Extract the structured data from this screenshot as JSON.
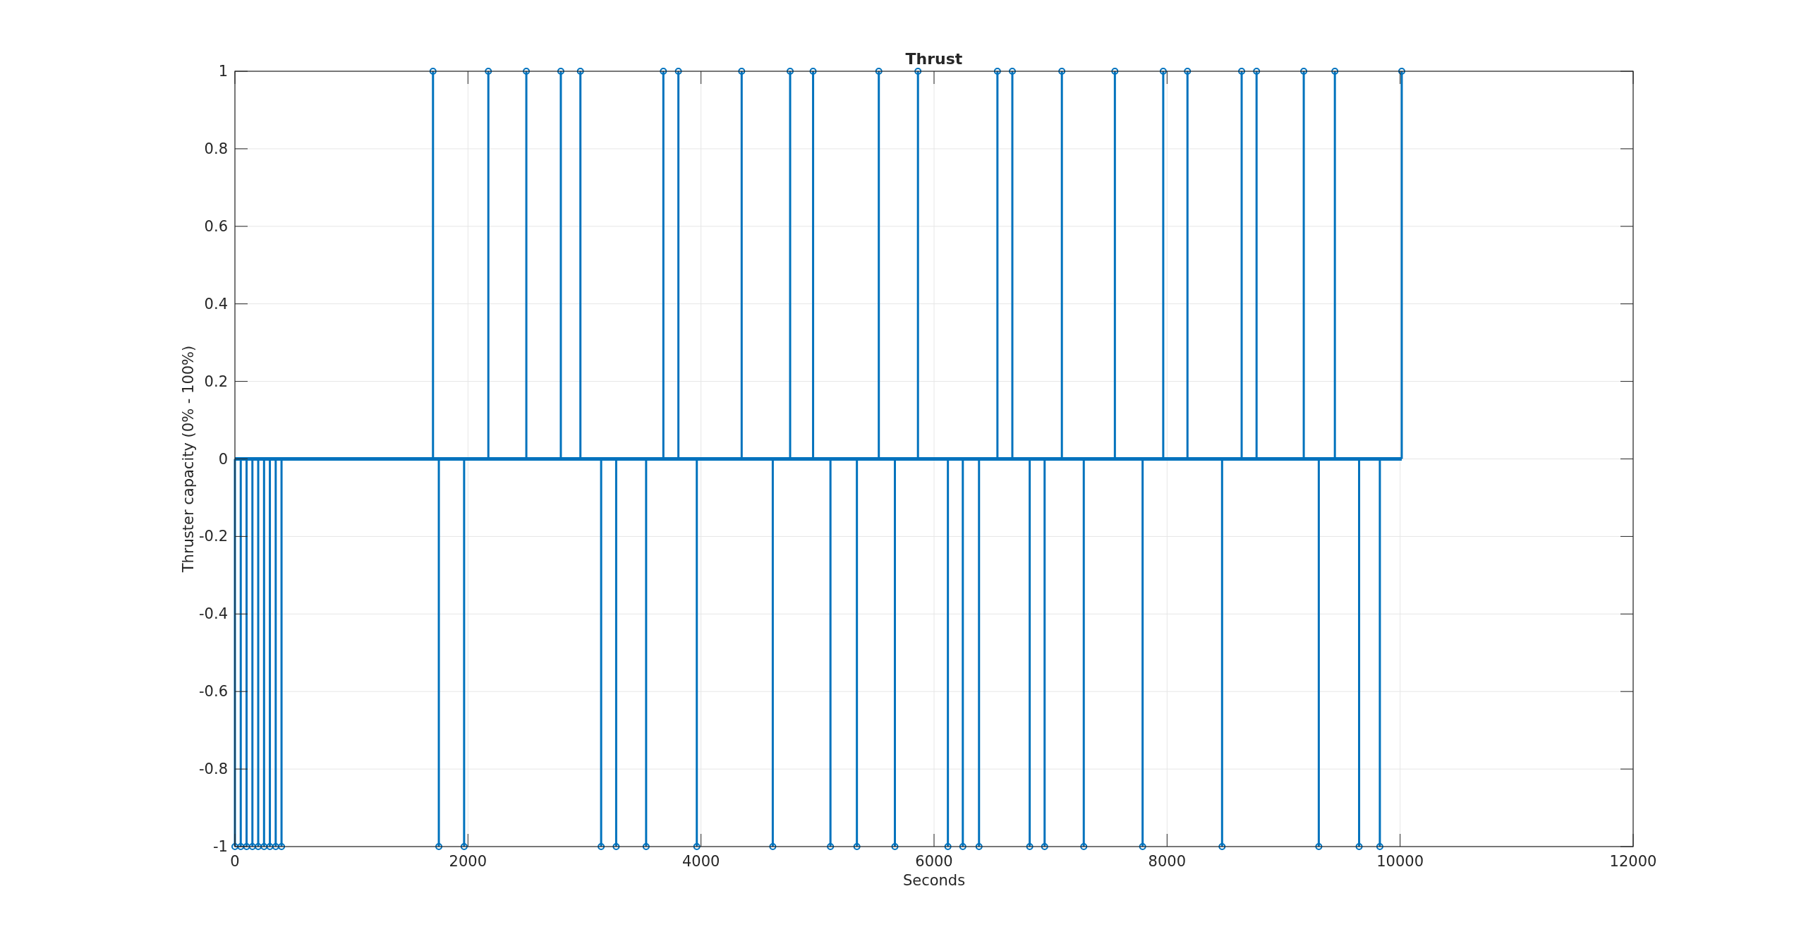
{
  "figure": {
    "chart_data": {
      "type": "scatter",
      "title": "Thrust",
      "xlabel": "Seconds",
      "ylabel": "Thruster capacity (0% - 100%)",
      "x": [
        0,
        50,
        100,
        150,
        200,
        250,
        300,
        350,
        400,
        1700,
        1750,
        1967,
        2175,
        2501,
        2797,
        2965,
        3143,
        3272,
        3529,
        3677,
        3806,
        3964,
        4349,
        4616,
        4765,
        4962,
        5111,
        5338,
        5526,
        5664,
        5862,
        6119,
        6247,
        6386,
        6544,
        6672,
        6821,
        6949,
        7097,
        7285,
        7552,
        7790,
        7967,
        8175,
        8472,
        8640,
        8768,
        9173,
        9302,
        9440,
        9648,
        9826,
        10014
      ],
      "grid": true,
      "ref_lines": [
        {
          "axis": "y",
          "value": 0
        }
      ],
      "series": [
        {
          "color": "#0072bd",
          "values": [
            -1,
            -1,
            -1,
            -1,
            -1,
            -1,
            -1,
            -1,
            -1,
            1,
            -1,
            -1,
            1,
            1,
            1,
            1,
            -1,
            -1,
            -1,
            1,
            1,
            -1,
            1,
            -1,
            1,
            1,
            -1,
            -1,
            1,
            -1,
            1,
            -1,
            -1,
            -1,
            1,
            1,
            -1,
            -1,
            1,
            -1,
            1,
            -1,
            1,
            1,
            -1,
            1,
            1,
            1,
            -1,
            1,
            -1,
            -1,
            1
          ]
        }
      ],
      "xlim": [
        0,
        12000
      ],
      "ylim": [
        -1,
        1
      ],
      "xticks": [
        0,
        2000,
        4000,
        6000,
        8000,
        10000,
        12000
      ],
      "yticks": [
        -1,
        -0.8,
        -0.6,
        -0.4,
        -0.2,
        0,
        0.2,
        0.4,
        0.6,
        0.8,
        1
      ]
    }
  }
}
